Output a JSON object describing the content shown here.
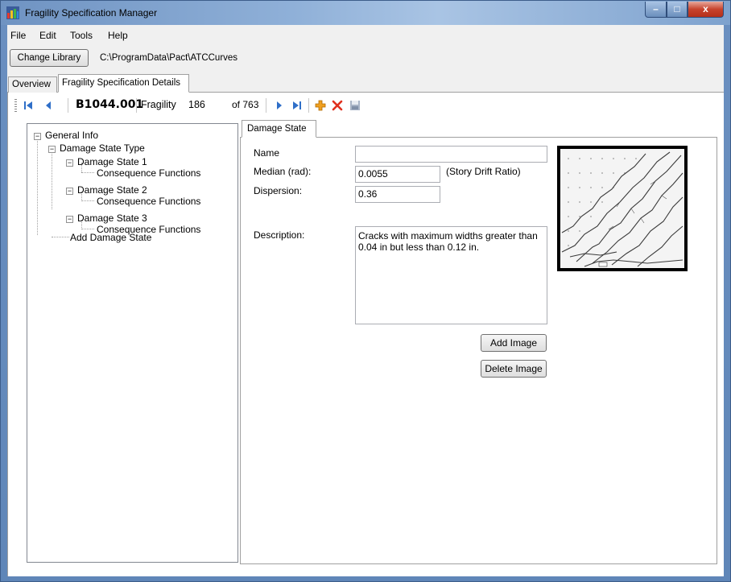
{
  "window": {
    "title": "Fragility Specification Manager",
    "controls": {
      "minimize": "–",
      "maximize": "□",
      "close": "x"
    }
  },
  "menu": [
    "File",
    "Edit",
    "Tools",
    "Help"
  ],
  "library": {
    "button_label": "Change Library",
    "path": "C:\\ProgramData\\Pact\\ATCCurves"
  },
  "tabs": [
    {
      "label": "Overview",
      "active": false
    },
    {
      "label": "Fragility Specification Details",
      "active": true
    }
  ],
  "navigator": {
    "record_id": "B1044.001",
    "fragility_label": "Fragility",
    "fragility_number": "186",
    "of_label": "of 763",
    "icons": [
      "move-first-icon",
      "move-previous-icon",
      "move-next-icon",
      "move-last-icon",
      "add-new-icon",
      "delete-icon",
      "save-icon"
    ]
  },
  "tree": {
    "nodes": [
      {
        "label": "General Info",
        "level": 0,
        "expander": "minus"
      },
      {
        "label": "Damage State Type",
        "level": 1,
        "expander": "minus"
      },
      {
        "label": "Damage State 1",
        "level": 2,
        "expander": "minus"
      },
      {
        "label": "Consequence Functions",
        "level": 3,
        "expander": "none"
      },
      {
        "label": "Damage State 2",
        "level": 2,
        "expander": "minus"
      },
      {
        "label": "Consequence Functions",
        "level": 3,
        "expander": "none"
      },
      {
        "label": "Damage State 3",
        "level": 2,
        "expander": "minus"
      },
      {
        "label": "Consequence Functions",
        "level": 3,
        "expander": "none"
      },
      {
        "label": "Add Damage State",
        "level": 1,
        "expander": "none"
      }
    ]
  },
  "damage_state": {
    "tab_label": "Damage State",
    "name_label": "Name",
    "name_value": "",
    "median_label": "Median (rad):",
    "median_value": "0.0055",
    "median_unit": "(Story Drift Ratio)",
    "dispersion_label": "Dispersion:",
    "dispersion_value": "0.36",
    "description_label": "Description:",
    "description_value": "Cracks with maximum widths greater than 0.04 in but less than 0.12 in.",
    "add_image_label": "Add Image",
    "delete_image_label": "Delete Image"
  },
  "colors": {
    "titlebar": "#7ea2ce",
    "nav_blue": "#2f6fc8",
    "add_orange": "#f0a020",
    "delete_red": "#e0301e"
  }
}
